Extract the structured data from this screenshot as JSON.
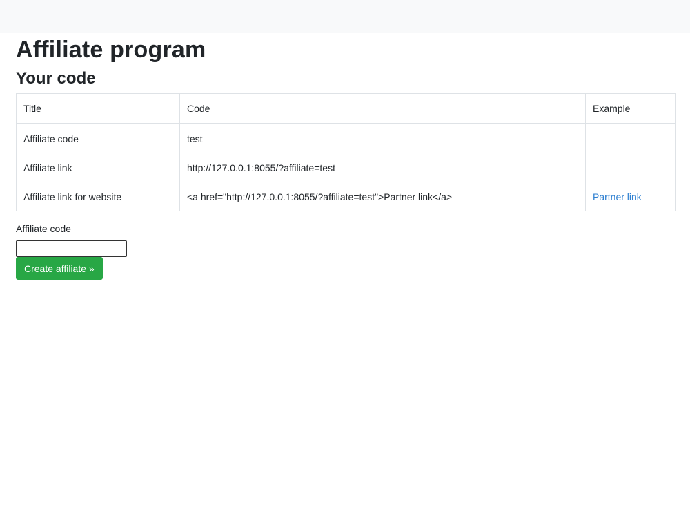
{
  "page": {
    "title": "Affiliate program",
    "section_title": "Your code"
  },
  "table": {
    "headers": [
      "Title",
      "Code",
      "Example"
    ],
    "rows": [
      {
        "title": "Affiliate code",
        "code": "test",
        "example": ""
      },
      {
        "title": "Affiliate link",
        "code": "http://127.0.0.1:8055/?affiliate=test",
        "example": ""
      },
      {
        "title": "Affiliate link for website",
        "code": "<a href=\"http://127.0.0.1:8055/?affiliate=test\">Partner link</a>",
        "example": "Partner link"
      }
    ]
  },
  "form": {
    "label": "Affiliate code",
    "input_value": "",
    "button_label": "Create affiliate »"
  },
  "colors": {
    "topbar": "#f8f9fa",
    "button": "#28a745",
    "link": "#2f80d1"
  }
}
